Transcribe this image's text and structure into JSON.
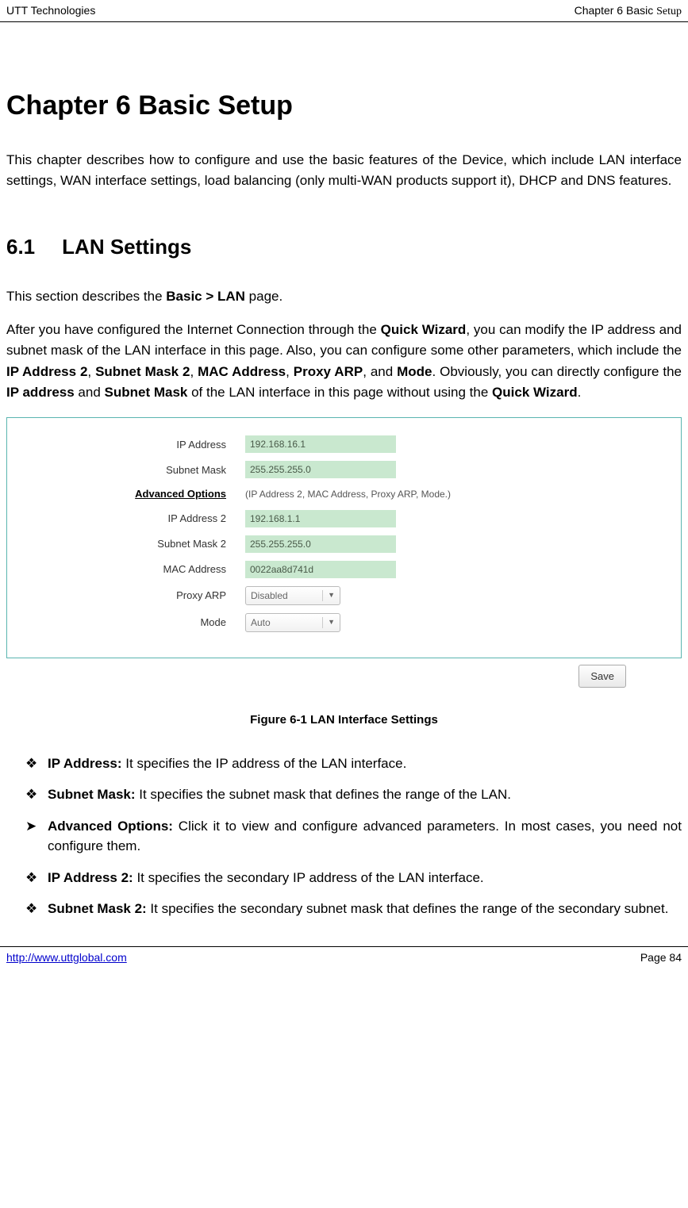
{
  "header": {
    "company": "UTT Technologies",
    "chapter_label": "Chapter 6 Basic ",
    "chapter_word": "Setup"
  },
  "title": "Chapter 6 Basic Setup",
  "intro": "This chapter describes how to configure and use the basic features of the Device, which include LAN interface settings, WAN interface settings, load balancing (only multi-WAN products support it), DHCP and DNS features.",
  "section": {
    "number": "6.1",
    "name": "LAN Settings"
  },
  "section_intro_prefix": "This section describes the ",
  "section_intro_bold": "Basic > LAN",
  "section_intro_suffix": " page.",
  "para2": {
    "t1": "After you have configured the Internet Connection through the ",
    "b1": "Quick Wizard",
    "t2": ", you can modify the IP address and subnet mask of the LAN interface in this page. Also, you can configure some other parameters, which include the ",
    "b2": "IP Address 2",
    "t3": ", ",
    "b3": "Subnet Mask 2",
    "t4": ", ",
    "b4": "MAC Address",
    "t5": ", ",
    "b5": "Proxy ARP",
    "t6": ", and ",
    "b6": "Mode",
    "t7": ". Obviously, you can directly configure the ",
    "b7": "IP address",
    "t8": " and ",
    "b8": "Subnet Mask",
    "t9": " of the LAN interface in this page without using the ",
    "b9": "Quick Wizard",
    "t10": "."
  },
  "form": {
    "ip_address_label": "IP Address",
    "ip_address_value": "192.168.16.1",
    "subnet_mask_label": "Subnet Mask",
    "subnet_mask_value": "255.255.255.0",
    "advanced_options_label": "Advanced Options",
    "advanced_hint": "(IP Address 2, MAC Address, Proxy ARP, Mode.)",
    "ip_address2_label": "IP Address 2",
    "ip_address2_value": "192.168.1.1",
    "subnet_mask2_label": "Subnet Mask 2",
    "subnet_mask2_value": "255.255.255.0",
    "mac_label": "MAC Address",
    "mac_value": "0022aa8d741d",
    "proxy_arp_label": "Proxy ARP",
    "proxy_arp_value": "Disabled",
    "mode_label": "Mode",
    "mode_value": "Auto",
    "save_label": "Save"
  },
  "figure_caption": "Figure 6-1 LAN Interface Settings",
  "bullets": {
    "diamond": "❖",
    "triangle": "➤",
    "ip_addr_b": "IP Address:",
    "ip_addr_t": " It specifies the IP address of the LAN interface.",
    "subnet_b": "Subnet Mask:",
    "subnet_t": " It specifies the subnet mask that defines the range of the LAN.",
    "adv_b": "Advanced Options:",
    "adv_t": " Click it to view and configure advanced parameters. In most cases, you need not configure them.",
    "ip2_b": "IP Address 2:",
    "ip2_t": " It specifies the secondary IP address of the LAN interface.",
    "sub2_b": "Subnet Mask 2:",
    "sub2_t": " It specifies the secondary subnet mask that defines the range of the secondary subnet."
  },
  "footer": {
    "url": "http://www.uttglobal.com",
    "page": "Page 84"
  }
}
